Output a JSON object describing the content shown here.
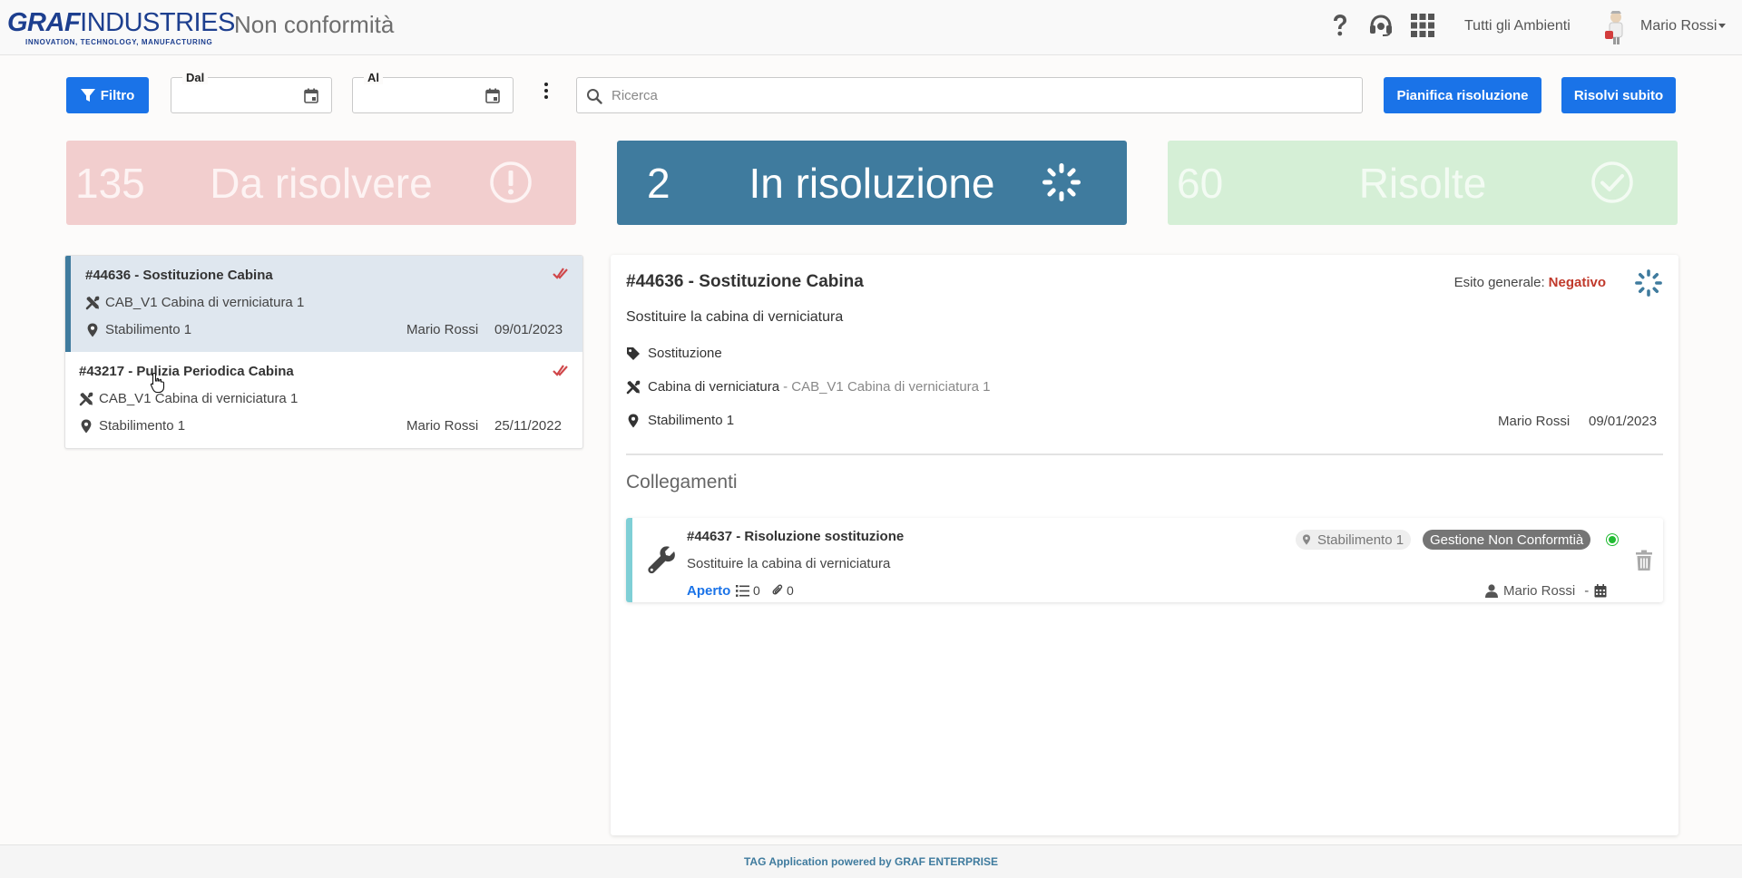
{
  "header": {
    "logo_brand": "GRAF",
    "logo_name": "INDUSTRIES",
    "logo_tagline": "INNOVATION, TECHNOLOGY, MANUFACTURING",
    "page_title": "Non conformità",
    "environments": "Tutti gli Ambienti",
    "user_name": "Mario Rossi"
  },
  "toolbar": {
    "filter_label": "Filtro",
    "date_from_label": "Dal",
    "date_to_label": "Al",
    "search_placeholder": "Ricerca",
    "plan_button": "Pianifica risoluzione",
    "resolve_button": "Risolvi subito"
  },
  "stats": [
    {
      "count": "135",
      "label": "Da risolvere",
      "bg": "#f2cece",
      "fg": "#fdf3f3"
    },
    {
      "count": "2",
      "label": "In risoluzione",
      "bg": "#3f7b9e",
      "fg": "#ffffff"
    },
    {
      "count": "60",
      "label": "Risolte",
      "bg": "#d5efd6",
      "fg": "#f3fbf3"
    }
  ],
  "list": [
    {
      "title": "#44636 - Sostituzione Cabina",
      "asset": "CAB_V1 Cabina di verniciatura 1",
      "location": "Stabilimento 1",
      "user": "Mario Rossi",
      "date": "09/01/2023"
    },
    {
      "title": "#43217 - Pulizia Periodica Cabina",
      "asset": "CAB_V1 Cabina di verniciatura 1",
      "location": "Stabilimento 1",
      "user": "Mario Rossi",
      "date": "25/11/2022"
    }
  ],
  "detail": {
    "title": "#44636 - Sostituzione Cabina",
    "esito_label": "Esito generale:",
    "esito_value": "Negativo",
    "description": "Sostituire la cabina di verniciatura",
    "tag": "Sostituzione",
    "asset_name": "Cabina di verniciatura",
    "asset_code": "- CAB_V1 Cabina di verniciatura 1",
    "location": "Stabilimento 1",
    "user": "Mario Rossi",
    "date": "09/01/2023",
    "links_heading": "Collegamenti"
  },
  "link": {
    "title": "#44637 - Risoluzione sostituzione",
    "description": "Sostituire la cabina di verniciatura",
    "status": "Aperto",
    "tasks": "0",
    "attachments": "0",
    "location": "Stabilimento 1",
    "module": "Gestione Non Conformtià",
    "user": "Mario Rossi",
    "dash": "-"
  },
  "footer": "TAG Application powered by GRAF ENTERPRISE",
  "colors": {
    "accent": "#1a73e8",
    "negative": "#c0392b",
    "status_ok": "#22bb33"
  }
}
